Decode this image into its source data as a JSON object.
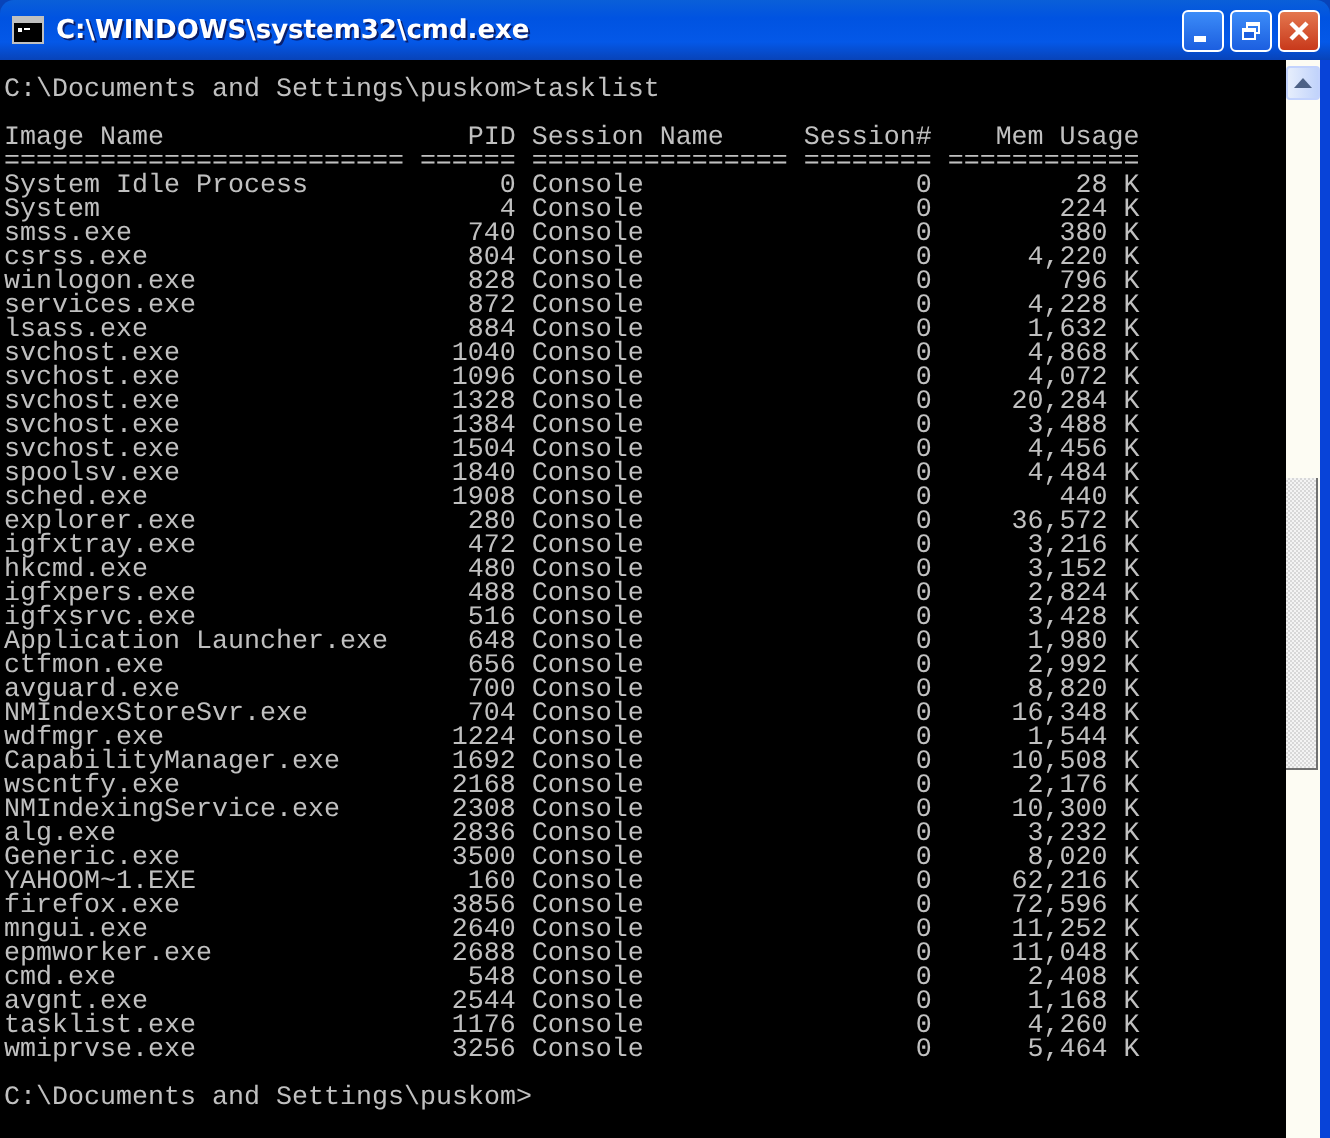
{
  "window": {
    "title": "C:\\WINDOWS\\system32\\cmd.exe"
  },
  "console": {
    "command_line": "C:\\Documents and Settings\\puskom>tasklist",
    "columns": [
      "Image Name",
      "PID",
      "Session Name",
      "Session#",
      "Mem Usage"
    ],
    "header_rule": [
      "=========================",
      "======",
      "================",
      "========",
      "============"
    ],
    "rows": [
      [
        "System Idle Process",
        "0",
        "Console",
        "0",
        "28 K"
      ],
      [
        "System",
        "4",
        "Console",
        "0",
        "224 K"
      ],
      [
        "smss.exe",
        "740",
        "Console",
        "0",
        "380 K"
      ],
      [
        "csrss.exe",
        "804",
        "Console",
        "0",
        "4,220 K"
      ],
      [
        "winlogon.exe",
        "828",
        "Console",
        "0",
        "796 K"
      ],
      [
        "services.exe",
        "872",
        "Console",
        "0",
        "4,228 K"
      ],
      [
        "lsass.exe",
        "884",
        "Console",
        "0",
        "1,632 K"
      ],
      [
        "svchost.exe",
        "1040",
        "Console",
        "0",
        "4,868 K"
      ],
      [
        "svchost.exe",
        "1096",
        "Console",
        "0",
        "4,072 K"
      ],
      [
        "svchost.exe",
        "1328",
        "Console",
        "0",
        "20,284 K"
      ],
      [
        "svchost.exe",
        "1384",
        "Console",
        "0",
        "3,488 K"
      ],
      [
        "svchost.exe",
        "1504",
        "Console",
        "0",
        "4,456 K"
      ],
      [
        "spoolsv.exe",
        "1840",
        "Console",
        "0",
        "4,484 K"
      ],
      [
        "sched.exe",
        "1908",
        "Console",
        "0",
        "440 K"
      ],
      [
        "explorer.exe",
        "280",
        "Console",
        "0",
        "36,572 K"
      ],
      [
        "igfxtray.exe",
        "472",
        "Console",
        "0",
        "3,216 K"
      ],
      [
        "hkcmd.exe",
        "480",
        "Console",
        "0",
        "3,152 K"
      ],
      [
        "igfxpers.exe",
        "488",
        "Console",
        "0",
        "2,824 K"
      ],
      [
        "igfxsrvc.exe",
        "516",
        "Console",
        "0",
        "3,428 K"
      ],
      [
        "Application Launcher.exe",
        "648",
        "Console",
        "0",
        "1,980 K"
      ],
      [
        "ctfmon.exe",
        "656",
        "Console",
        "0",
        "2,992 K"
      ],
      [
        "avguard.exe",
        "700",
        "Console",
        "0",
        "8,820 K"
      ],
      [
        "NMIndexStoreSvr.exe",
        "704",
        "Console",
        "0",
        "16,348 K"
      ],
      [
        "wdfmgr.exe",
        "1224",
        "Console",
        "0",
        "1,544 K"
      ],
      [
        "CapabilityManager.exe",
        "1692",
        "Console",
        "0",
        "10,508 K"
      ],
      [
        "wscntfy.exe",
        "2168",
        "Console",
        "0",
        "2,176 K"
      ],
      [
        "NMIndexingService.exe",
        "2308",
        "Console",
        "0",
        "10,300 K"
      ],
      [
        "alg.exe",
        "2836",
        "Console",
        "0",
        "3,232 K"
      ],
      [
        "Generic.exe",
        "3500",
        "Console",
        "0",
        "8,020 K"
      ],
      [
        "YAHOOM~1.EXE",
        "160",
        "Console",
        "0",
        "62,216 K"
      ],
      [
        "firefox.exe",
        "3856",
        "Console",
        "0",
        "72,596 K"
      ],
      [
        "mngui.exe",
        "2640",
        "Console",
        "0",
        "11,252 K"
      ],
      [
        "epmworker.exe",
        "2688",
        "Console",
        "0",
        "11,048 K"
      ],
      [
        "cmd.exe",
        "548",
        "Console",
        "0",
        "2,408 K"
      ],
      [
        "avgnt.exe",
        "2544",
        "Console",
        "0",
        "1,168 K"
      ],
      [
        "tasklist.exe",
        "1176",
        "Console",
        "0",
        "4,260 K"
      ],
      [
        "wmiprvse.exe",
        "3256",
        "Console",
        "0",
        "5,464 K"
      ]
    ],
    "final_prompt": "C:\\Documents and Settings\\puskom>"
  }
}
